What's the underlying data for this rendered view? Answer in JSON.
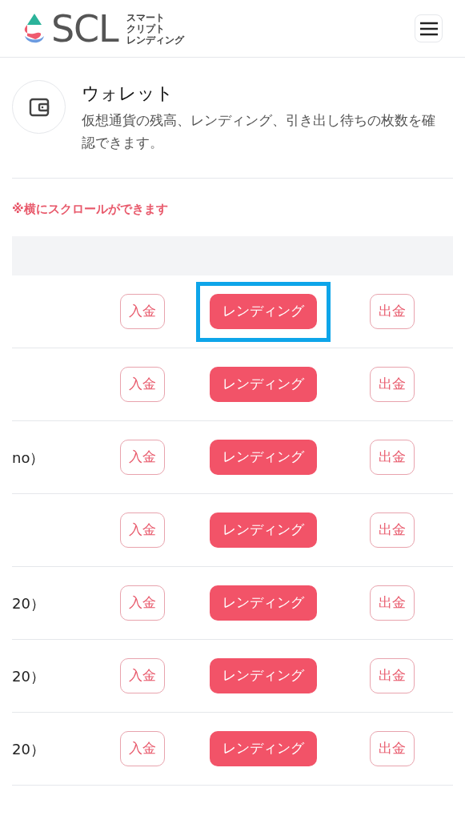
{
  "header": {
    "logo_text": "SCL",
    "logo_tagline": [
      "スマート",
      "クリプト",
      "レンディング"
    ]
  },
  "section": {
    "title": "ウォレット",
    "description": "仮想通貨の残高、レンディング、引き出し待ちの枚数を確認できます。"
  },
  "scroll_note": "※横にスクロールができます",
  "rows": [
    {
      "name": "",
      "deposit": "入金",
      "lending": "レンディング",
      "withdraw": "出金",
      "highlighted": true
    },
    {
      "name": "",
      "deposit": "入金",
      "lending": "レンディング",
      "withdraw": "出金",
      "highlighted": false
    },
    {
      "name": "no）",
      "deposit": "入金",
      "lending": "レンディング",
      "withdraw": "出金",
      "highlighted": false
    },
    {
      "name": "",
      "deposit": "入金",
      "lending": "レンディング",
      "withdraw": "出金",
      "highlighted": false
    },
    {
      "name": "20）",
      "deposit": "入金",
      "lending": "レンディング",
      "withdraw": "出金",
      "highlighted": false
    },
    {
      "name": "20）",
      "deposit": "入金",
      "lending": "レンディング",
      "withdraw": "出金",
      "highlighted": false
    },
    {
      "name": "20）",
      "deposit": "入金",
      "lending": "レンディング",
      "withdraw": "出金",
      "highlighted": false
    }
  ]
}
